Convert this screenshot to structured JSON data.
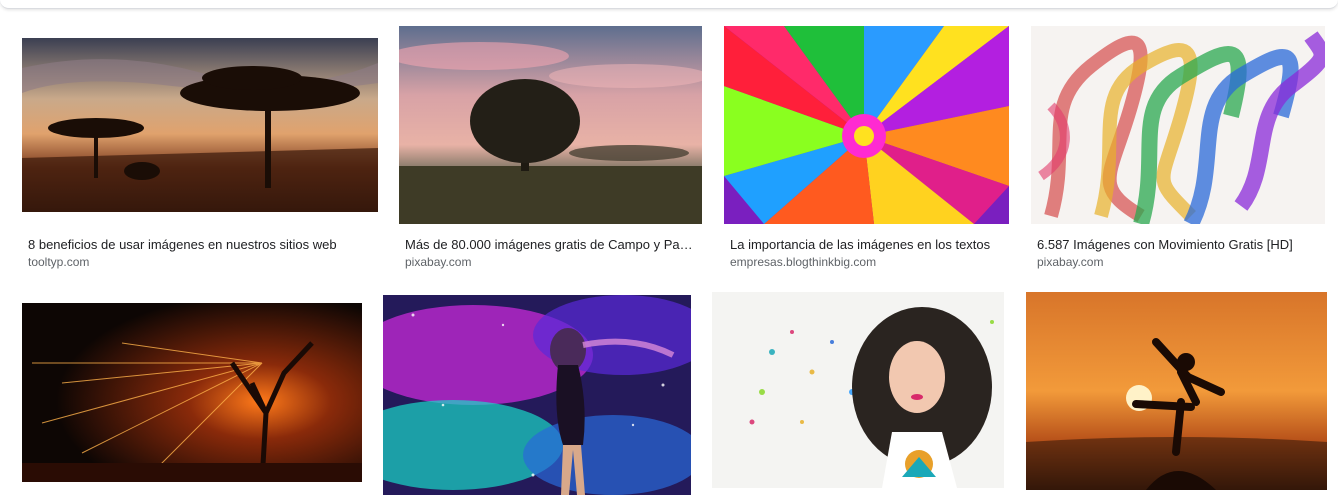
{
  "results": [
    {
      "title": "8 beneficios de usar imágenes en nuestros sitios web",
      "source": "tooltyp.com"
    },
    {
      "title": "Más de 80.000 imágenes gratis de Campo y Paisaje - Pixabay",
      "source": "pixabay.com"
    },
    {
      "title": "La importancia de las imágenes en los textos",
      "source": "empresas.blogthinkbig.com"
    },
    {
      "title": "6.587 Imágenes con Movimiento Gratis [HD]",
      "source": "pixabay.com"
    }
  ],
  "images": [
    {
      "name": "acacia-sunset-savanna"
    },
    {
      "name": "lone-tree-field-sunset"
    },
    {
      "name": "colorful-fractal-burst"
    },
    {
      "name": "rainbow-smoke"
    },
    {
      "name": "fire-sparks-tree"
    },
    {
      "name": "girl-cosmic-nebula"
    },
    {
      "name": "curly-hair-girl-illustration"
    },
    {
      "name": "silhouette-sunset-balance"
    }
  ]
}
